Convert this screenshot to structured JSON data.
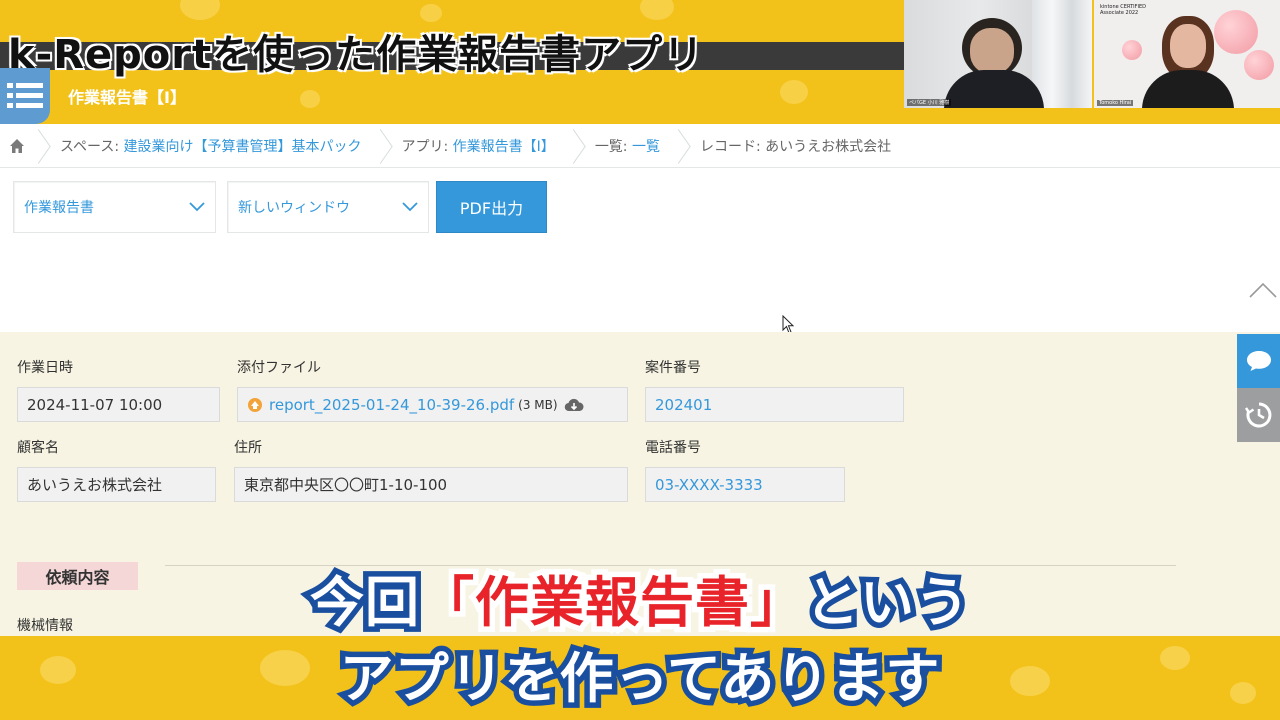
{
  "video": {
    "title": "k-Reportを使った作業報告書アプリ",
    "subtitle_line1_pre": "今回",
    "subtitle_line1_highlight": "「作業報告書」",
    "subtitle_line1_post": "という",
    "subtitle_line2": "アプリを作ってあります",
    "cam1_label": "ペパGE 小川 雅樹",
    "cam2_badge_line1": "kintone CERTIFIED",
    "cam2_badge_line2": "Associate 2022",
    "cam2_label": "Tomoko Hirai"
  },
  "app": {
    "header_title": "作業報告書【I】"
  },
  "breadcrumb": [
    {
      "label": "スペース: ",
      "value": "建設業向け【予算書管理】基本パック"
    },
    {
      "label": "アプリ: ",
      "value": "作業報告書【I】"
    },
    {
      "label": "一覧: ",
      "value": "一覧"
    },
    {
      "label": "レコード: ",
      "value": "あいうえお株式会社"
    }
  ],
  "toolbar": {
    "template_select": "作業報告書",
    "window_select": "新しいウィンドウ",
    "pdf_button": "PDF出力"
  },
  "record": {
    "work_datetime": {
      "label": "作業日時",
      "value": "2024-11-07 10:00"
    },
    "attachment": {
      "label": "添付ファイル",
      "filename": "report_2025-01-24_10-39-26.pdf",
      "size": "(3 MB)"
    },
    "case_number": {
      "label": "案件番号",
      "value": "202401"
    },
    "customer": {
      "label": "顧客名",
      "value": "あいうえお株式会社"
    },
    "address": {
      "label": "住所",
      "value": "東京都中央区〇〇町1-10-100"
    },
    "phone": {
      "label": "電話番号",
      "value": "03-XXXX-3333"
    },
    "section_request": "依頼内容",
    "machine_info": "機械情報"
  },
  "colors": {
    "frame_yellow": "#f3c21a",
    "accent_blue": "#3498db",
    "record_bg": "#f7f4e3",
    "subtitle_outline": "#1a4fa0",
    "subtitle_highlight": "#e8242a"
  },
  "icons": {
    "menu": "hamburger-icon",
    "home": "home-icon",
    "chevron": "chevron-down-icon",
    "attachment": "file-icon",
    "download": "cloud-download-icon",
    "scroll_top": "chevron-up-icon",
    "comment": "comment-icon",
    "history": "history-icon"
  }
}
